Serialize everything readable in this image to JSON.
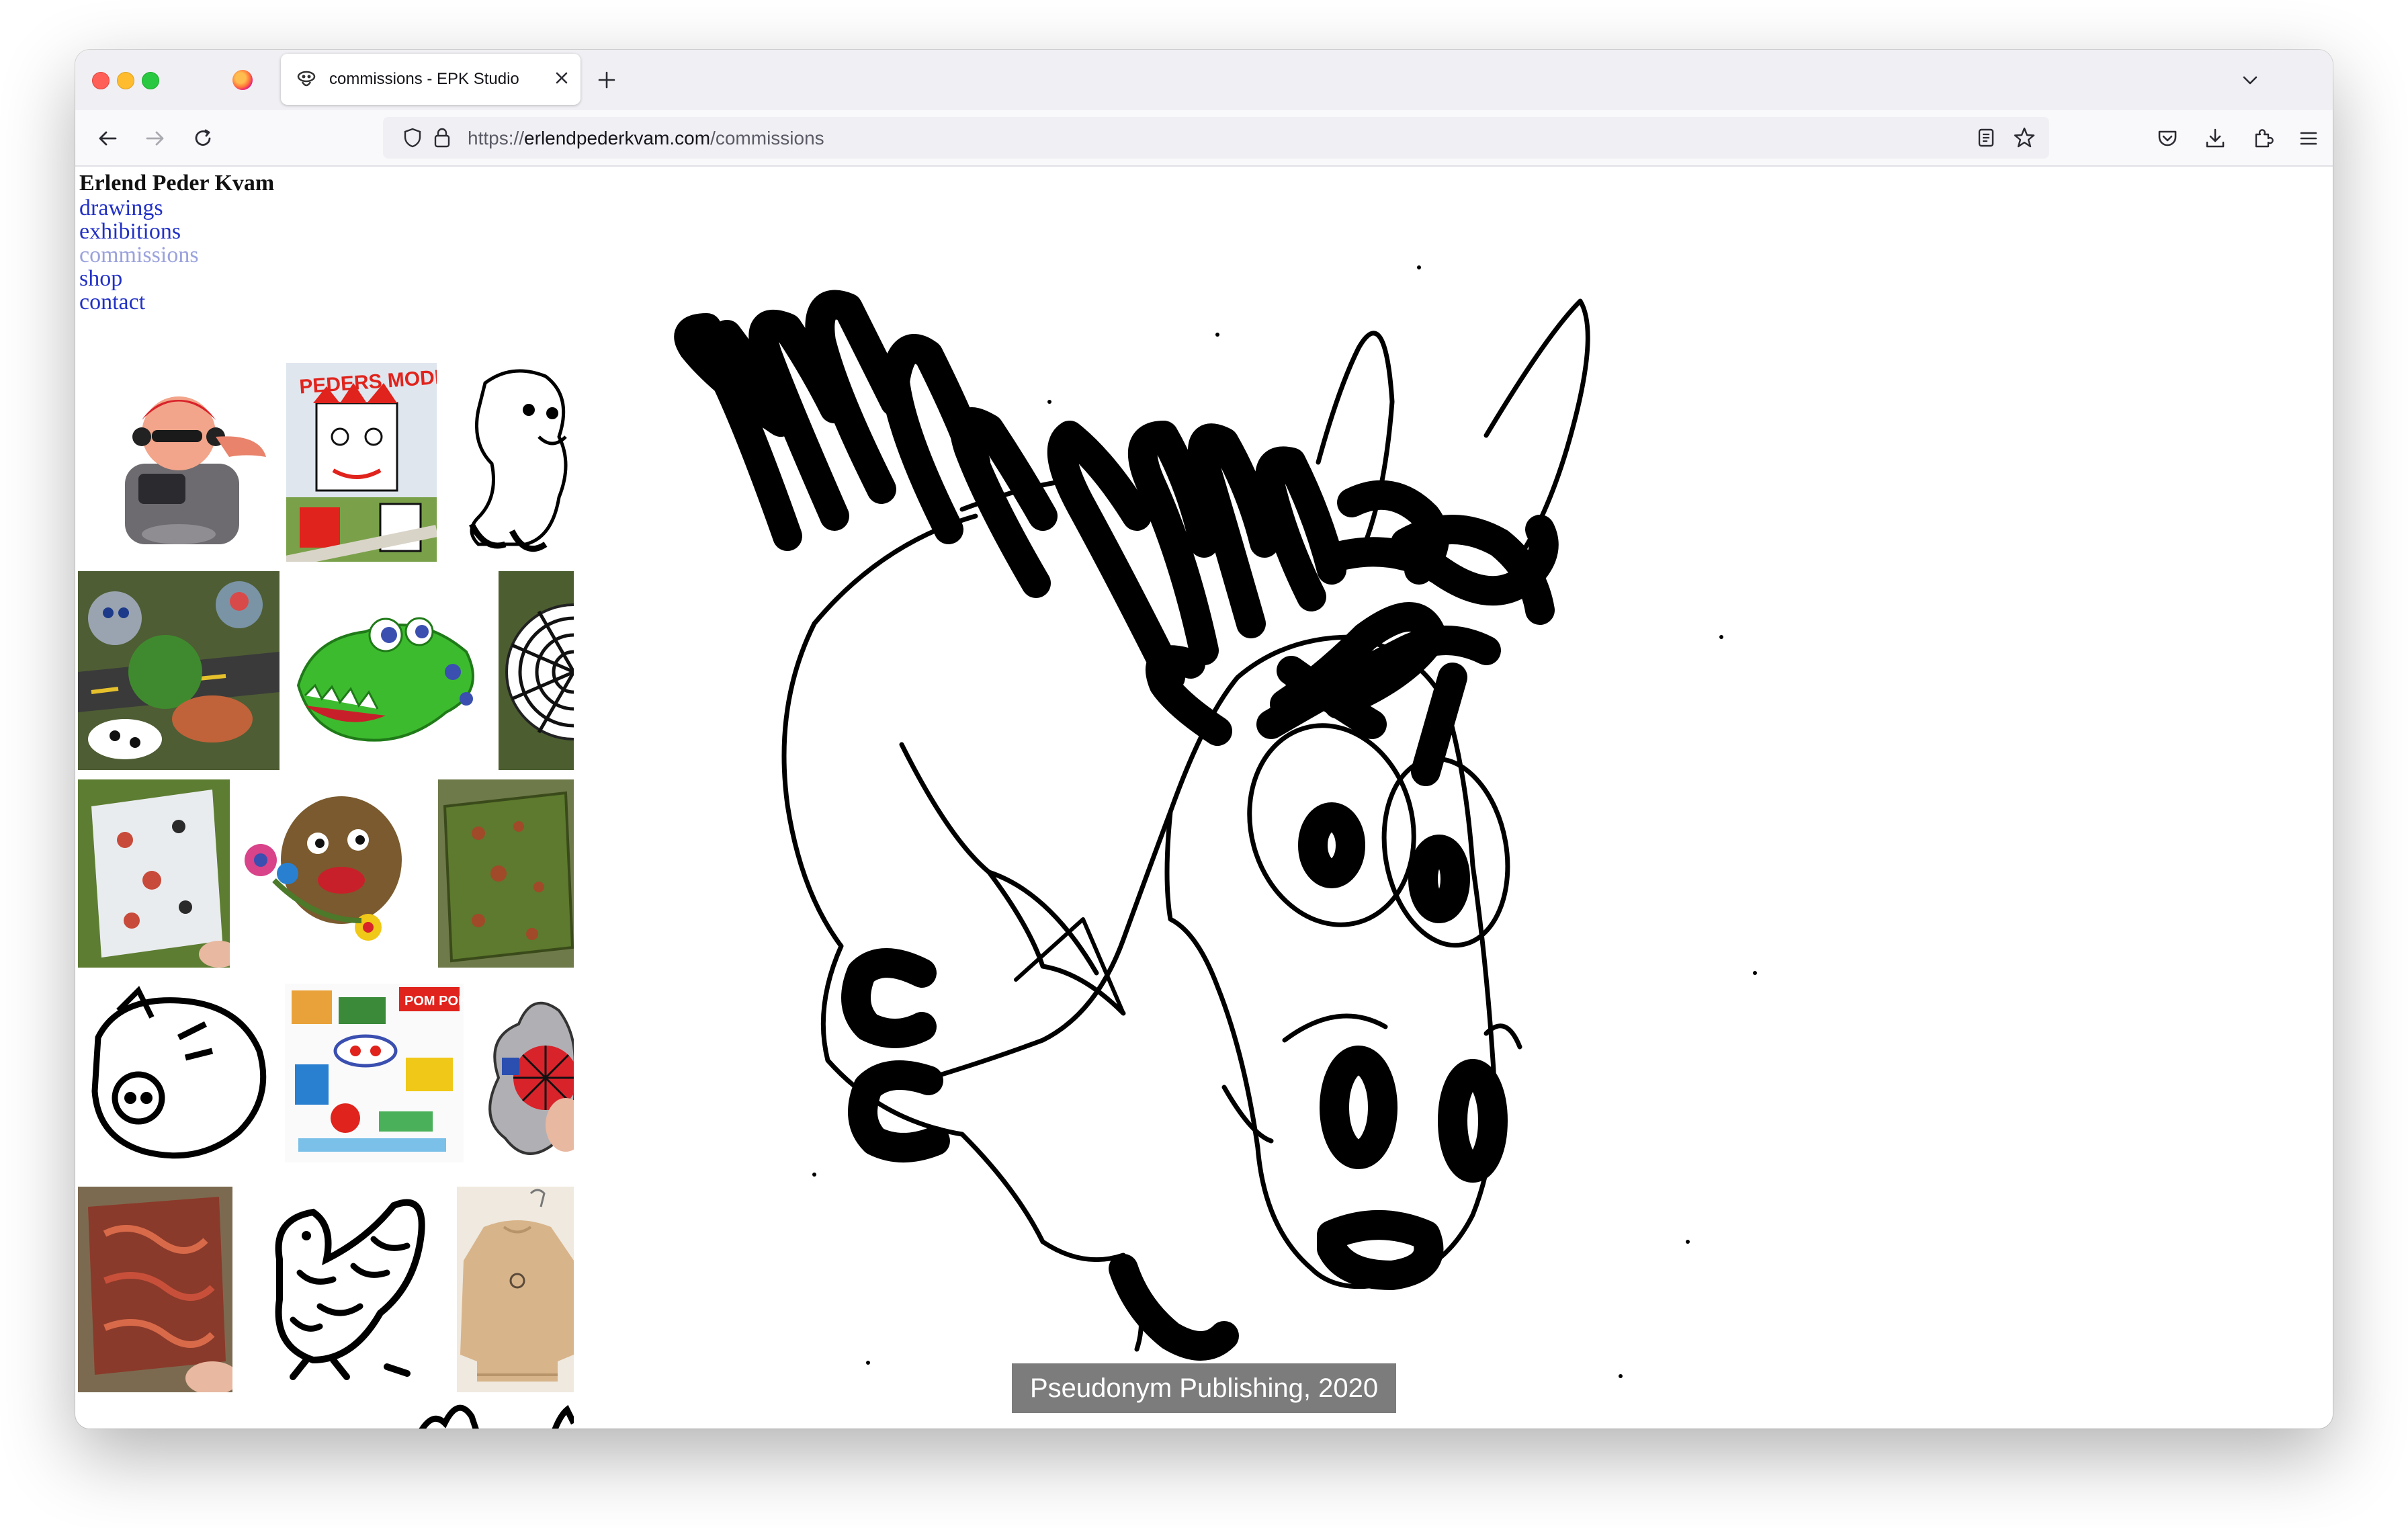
{
  "browser": {
    "tab": {
      "title": "commissions - EPK Studio"
    },
    "url": {
      "prefix": "https://",
      "host": "erlendpederkvam.com",
      "path": "/commissions"
    }
  },
  "site": {
    "name": "Erlend Peder Kvam",
    "nav": [
      "drawings",
      "exhibitions",
      "commissions",
      "shop",
      "contact"
    ],
    "current_nav": "commissions"
  },
  "gallery": {
    "thumbnails": [
      "figurine with headphones",
      "PEDERS MODE poster",
      "dog drawing",
      "painted stones collage",
      "green crocodile sculpture",
      "spiderweb plate",
      "painted tile in grass",
      "flower and bread face",
      "green tray",
      "pig drawing",
      "Pom Poko collage",
      "spider-man hand",
      "red painted box",
      "bird drawing",
      "beige sweatshirt"
    ],
    "selected_caption": "Pseudonym Publishing, 2020"
  },
  "colors": {
    "link": "#2231c6",
    "link_current": "#9aa2dd",
    "caption_bg": "#5f5f5f"
  }
}
